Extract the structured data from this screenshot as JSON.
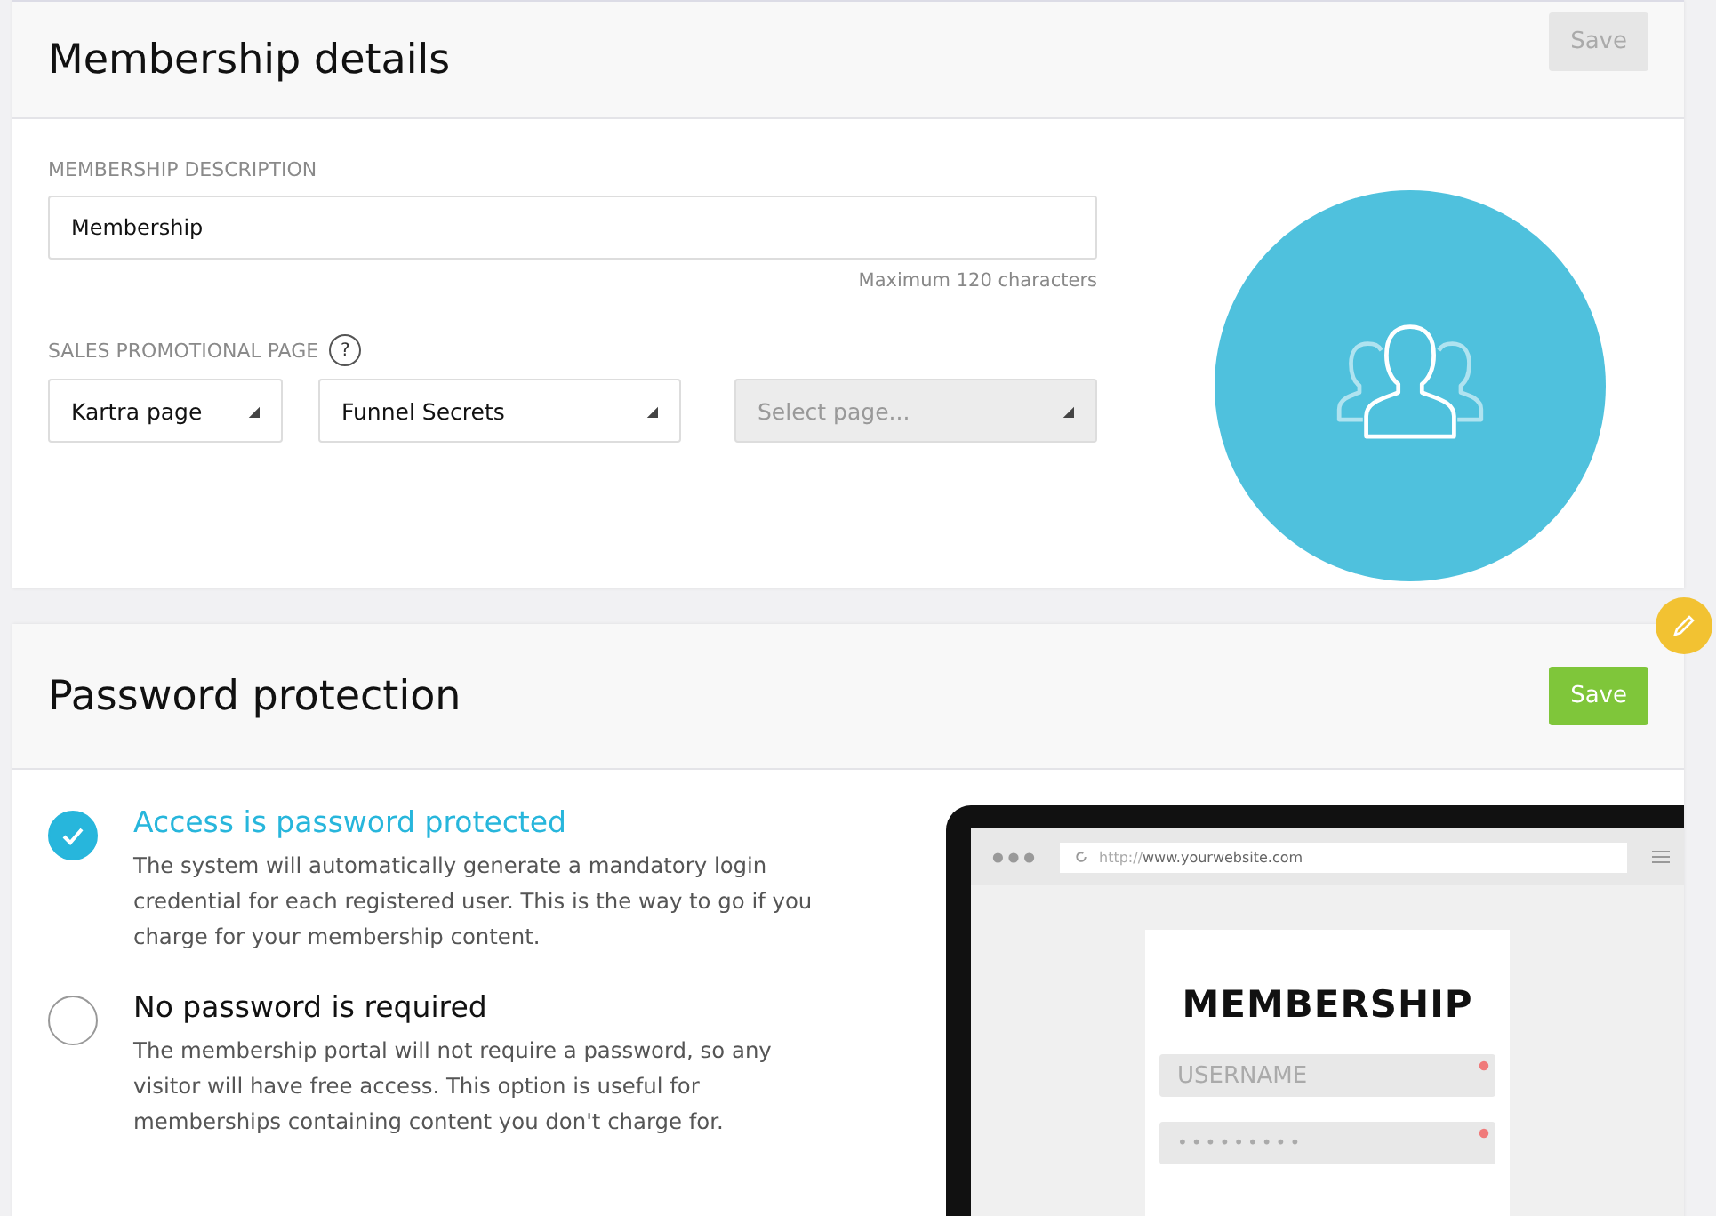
{
  "membership_details": {
    "title": "Membership details",
    "save_button": {
      "label": "Save",
      "disabled": true
    },
    "description": {
      "label": "MEMBERSHIP DESCRIPTION",
      "value": "Membership",
      "hint": "Maximum 120 characters"
    },
    "sales_page": {
      "label": "SALES PROMOTIONAL PAGE",
      "help": "?",
      "selects": [
        {
          "value": "Kartra page",
          "disabled": false
        },
        {
          "value": "Funnel Secrets",
          "disabled": false
        },
        {
          "placeholder": "Select page...",
          "disabled": true
        }
      ]
    }
  },
  "password_protection": {
    "title": "Password protection",
    "save_button": {
      "label": "Save",
      "disabled": false
    },
    "options": [
      {
        "title": "Access is password protected",
        "text": "The system will automatically generate a mandatory login credential for each registered user. This is the way to go if you charge for your membership content.",
        "selected": true
      },
      {
        "title": "No password is required",
        "text": "The membership portal will not require a password, so any visitor will have free access. This option is useful for memberships containing content you don't charge for.",
        "selected": false
      }
    ],
    "preview": {
      "url_prefix": "http://",
      "url_host": "www.yourwebsite.com",
      "heading": "MEMBERSHIP",
      "username_placeholder": "USERNAME",
      "password_mask": "•••••••••"
    }
  }
}
